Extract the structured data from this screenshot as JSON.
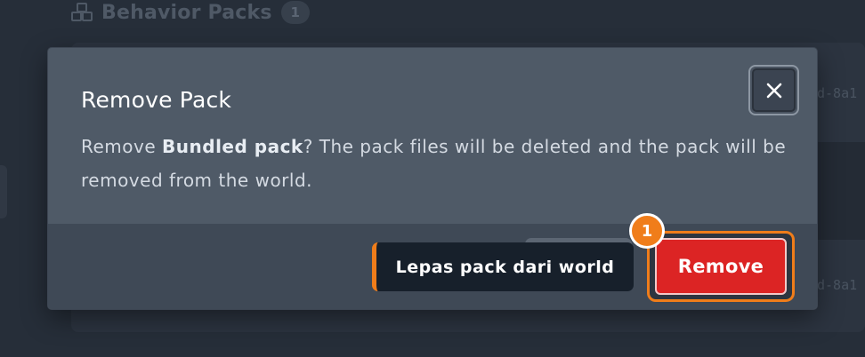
{
  "background": {
    "section_title": "Behavior Packs",
    "section_count": "1",
    "hash_fragment_top": "d-8a1",
    "hash_fragment_bottom": "d-8a1",
    "section_icon": "cubes-icon"
  },
  "dialog": {
    "title": "Remove Pack",
    "message_prefix": "Remove ",
    "pack_name": "Bundled pack",
    "message_suffix": "? The pack files will be deleted and the pack will be removed from the world.",
    "close_icon": "close-icon",
    "remove_label": "Remove"
  },
  "tour": {
    "tooltip_text": "Lepas pack dari world",
    "step_number": "1",
    "accent_color": "#f07d1a"
  },
  "colors": {
    "danger": "#dc2424",
    "dialog_bg": "#4f5a67",
    "page_bg": "#262e39"
  }
}
